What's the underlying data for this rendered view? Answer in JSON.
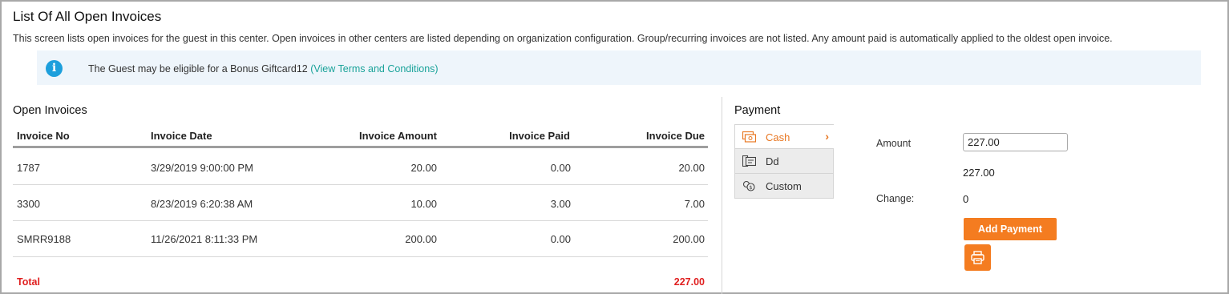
{
  "header": {
    "title": "List Of All Open Invoices",
    "description": "This screen lists open invoices for the guest in this center. Open invoices in other centers are listed depending on organization configuration. Group/recurring invoices are not listed. Any amount paid is automatically applied to the oldest open invoice."
  },
  "info_banner": {
    "icon": "info-icon",
    "text": "The Guest may be eligible for a Bonus Giftcard12 ",
    "link": "(View Terms and Conditions)"
  },
  "invoices": {
    "title": "Open Invoices",
    "columns": [
      "Invoice No",
      "Invoice Date",
      "Invoice Amount",
      "Invoice Paid",
      "Invoice Due"
    ],
    "rows": [
      {
        "no": "1787",
        "date": "3/29/2019 9:00:00 PM",
        "amount": "20.00",
        "paid": "0.00",
        "due": "20.00"
      },
      {
        "no": "3300",
        "date": "8/23/2019 6:20:38 AM",
        "amount": "10.00",
        "paid": "3.00",
        "due": "7.00"
      },
      {
        "no": "SMRR9188",
        "date": "11/26/2021 8:11:33 PM",
        "amount": "200.00",
        "paid": "0.00",
        "due": "200.00"
      }
    ],
    "total_label": "Total",
    "total_value": "227.00"
  },
  "payment": {
    "title": "Payment",
    "methods": [
      {
        "label": "Cash",
        "icon": "cash-icon",
        "active": true
      },
      {
        "label": "Dd",
        "icon": "direct-debit-icon",
        "active": false
      },
      {
        "label": "Custom",
        "icon": "custom-payment-icon",
        "active": false
      }
    ],
    "amount_label": "Amount",
    "amount_value": "227.00",
    "amount_display": "227.00",
    "change_label": "Change:",
    "change_value": "0",
    "add_button": "Add Payment",
    "print_icon": "print-icon"
  },
  "colors": {
    "accent": "#f47c20",
    "link": "#1aa39a",
    "total": "#e02020",
    "info": "#1d9fdc"
  }
}
